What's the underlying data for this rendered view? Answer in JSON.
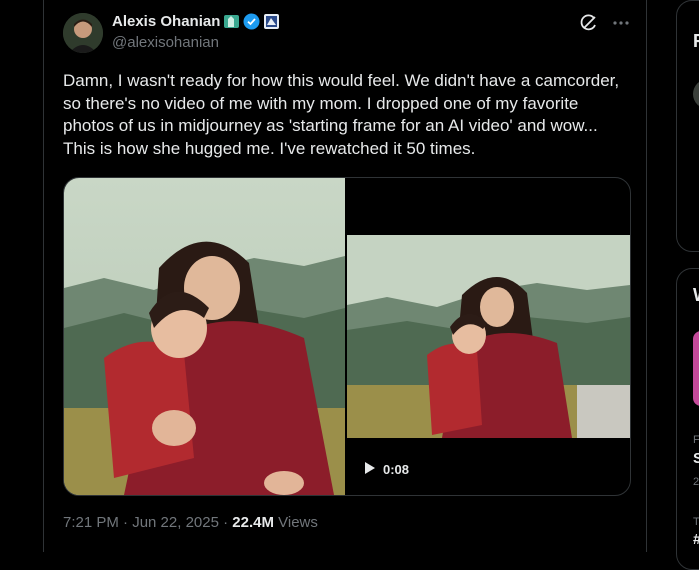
{
  "tweet": {
    "display_name": "Alexis Ohanian",
    "handle": "@alexisohanian",
    "text": "Damn, I wasn't ready for how this would feel. We didn't have a camcorder, so there's no video of me with my mom. I dropped one of my favorite photos of us in midjourney as 'starting frame for an AI video' and wow... This is how she hugged me. I've rewatched it 50 times.",
    "video_time": "0:08",
    "timestamp": "7:21 PM · Jun 22, 2025 · ",
    "views_count": "22.4M",
    "views_label": " Views"
  },
  "right_sidebar": {
    "card1_letter": "R",
    "card2_letter": "W",
    "item_small_1": "F",
    "item_big_1": "S",
    "item_small_2": "2",
    "item_small_3": "T",
    "item_big_2": "#"
  },
  "icons": [
    "avatar",
    "nyc-flag-icon",
    "verified-badge-icon",
    "affiliate-icon",
    "grok-icon",
    "more-icon",
    "play-icon"
  ],
  "colors": {
    "verified": "#1d9bf0",
    "text": "#e7e9ea",
    "muted": "#71767b",
    "border": "#2f3336"
  }
}
